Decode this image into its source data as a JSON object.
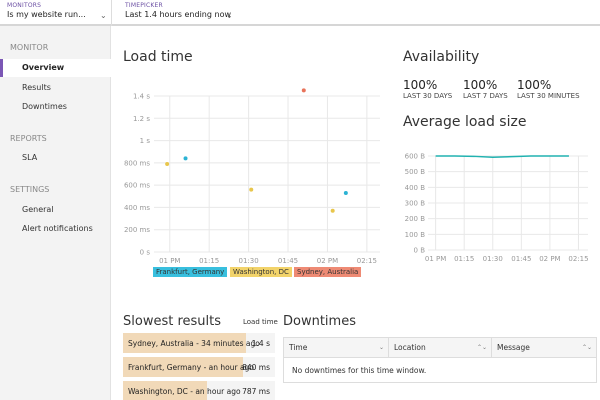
{
  "topbar": {
    "monitors_label": "MONITORS",
    "monitors_value": "Is my website run...",
    "timepicker_label": "TIMEPICKER",
    "timepicker_value": "Last 1.4 hours ending now"
  },
  "sidebar": {
    "sections": [
      {
        "title": "MONITOR",
        "items": [
          "Overview",
          "Results",
          "Downtimes"
        ]
      },
      {
        "title": "REPORTS",
        "items": [
          "SLA"
        ]
      },
      {
        "title": "SETTINGS",
        "items": [
          "General",
          "Alert notifications"
        ]
      }
    ],
    "active": "Overview"
  },
  "load_time": {
    "title": "Load time",
    "chart_data": {
      "type": "scatter",
      "x_ticks": [
        "01 PM",
        "01:15",
        "01:30",
        "01:45",
        "02 PM",
        "02:15"
      ],
      "y_ticks": [
        "0 s",
        "200 ms",
        "400 ms",
        "600 ms",
        "800 ms",
        "1 s",
        "1.2 s",
        "1.4 s"
      ],
      "ylim": [
        0,
        1.4
      ],
      "xlim_minutes": [
        0,
        80
      ],
      "grid": true,
      "legend_position": "bottom",
      "series": [
        {
          "name": "Frankfurt, Germany",
          "color": "#2bb3d4",
          "points": [
            {
              "t": 6,
              "v": 0.84
            },
            {
              "t": 67,
              "v": 0.53
            }
          ]
        },
        {
          "name": "Washington, DC",
          "color": "#e8c64c",
          "points": [
            {
              "t": -1,
              "v": 0.79
            },
            {
              "t": 31,
              "v": 0.56
            },
            {
              "t": 62,
              "v": 0.37
            }
          ]
        },
        {
          "name": "Sydney, Australia",
          "color": "#e8735a",
          "points": [
            {
              "t": 51,
              "v": 1.45
            }
          ]
        }
      ]
    }
  },
  "availability": {
    "title": "Availability",
    "items": [
      {
        "pct": "100%",
        "period": "LAST 30 DAYS"
      },
      {
        "pct": "100%",
        "period": "LAST 7 DAYS"
      },
      {
        "pct": "100%",
        "period": "LAST 30 MINUTES"
      }
    ]
  },
  "avg_load_size": {
    "title": "Average load size",
    "chart_data": {
      "type": "line",
      "x_ticks": [
        "01 PM",
        "01:15",
        "01:30",
        "01:45",
        "02 PM",
        "02:15"
      ],
      "y_ticks": [
        "0 B",
        "100 B",
        "200 B",
        "300 B",
        "400 B",
        "500 B",
        "600 B"
      ],
      "ylim": [
        0,
        600
      ],
      "grid": true,
      "series": [
        {
          "color": "#21b2b0",
          "points": [
            {
              "t": 0,
              "v": 600
            },
            {
              "t": 10,
              "v": 600
            },
            {
              "t": 20,
              "v": 598
            },
            {
              "t": 30,
              "v": 592
            },
            {
              "t": 40,
              "v": 596
            },
            {
              "t": 50,
              "v": 600
            },
            {
              "t": 60,
              "v": 600
            },
            {
              "t": 70,
              "v": 600
            }
          ]
        }
      ]
    }
  },
  "slowest": {
    "title": "Slowest results",
    "col_header": "Load time",
    "rows": [
      {
        "location": "Sydney, Australia - 34 minutes ago",
        "time": "1.4 s",
        "fraction": 0.81
      },
      {
        "location": "Frankfurt, Germany - an hour ago",
        "time": "840 ms",
        "fraction": 0.79
      },
      {
        "location": "Washington, DC - an hour ago",
        "time": "787 ms",
        "fraction": 0.55
      }
    ]
  },
  "downtimes": {
    "title": "Downtimes",
    "columns": [
      "Time",
      "Location",
      "Message"
    ],
    "empty": "No downtimes for this time window."
  }
}
